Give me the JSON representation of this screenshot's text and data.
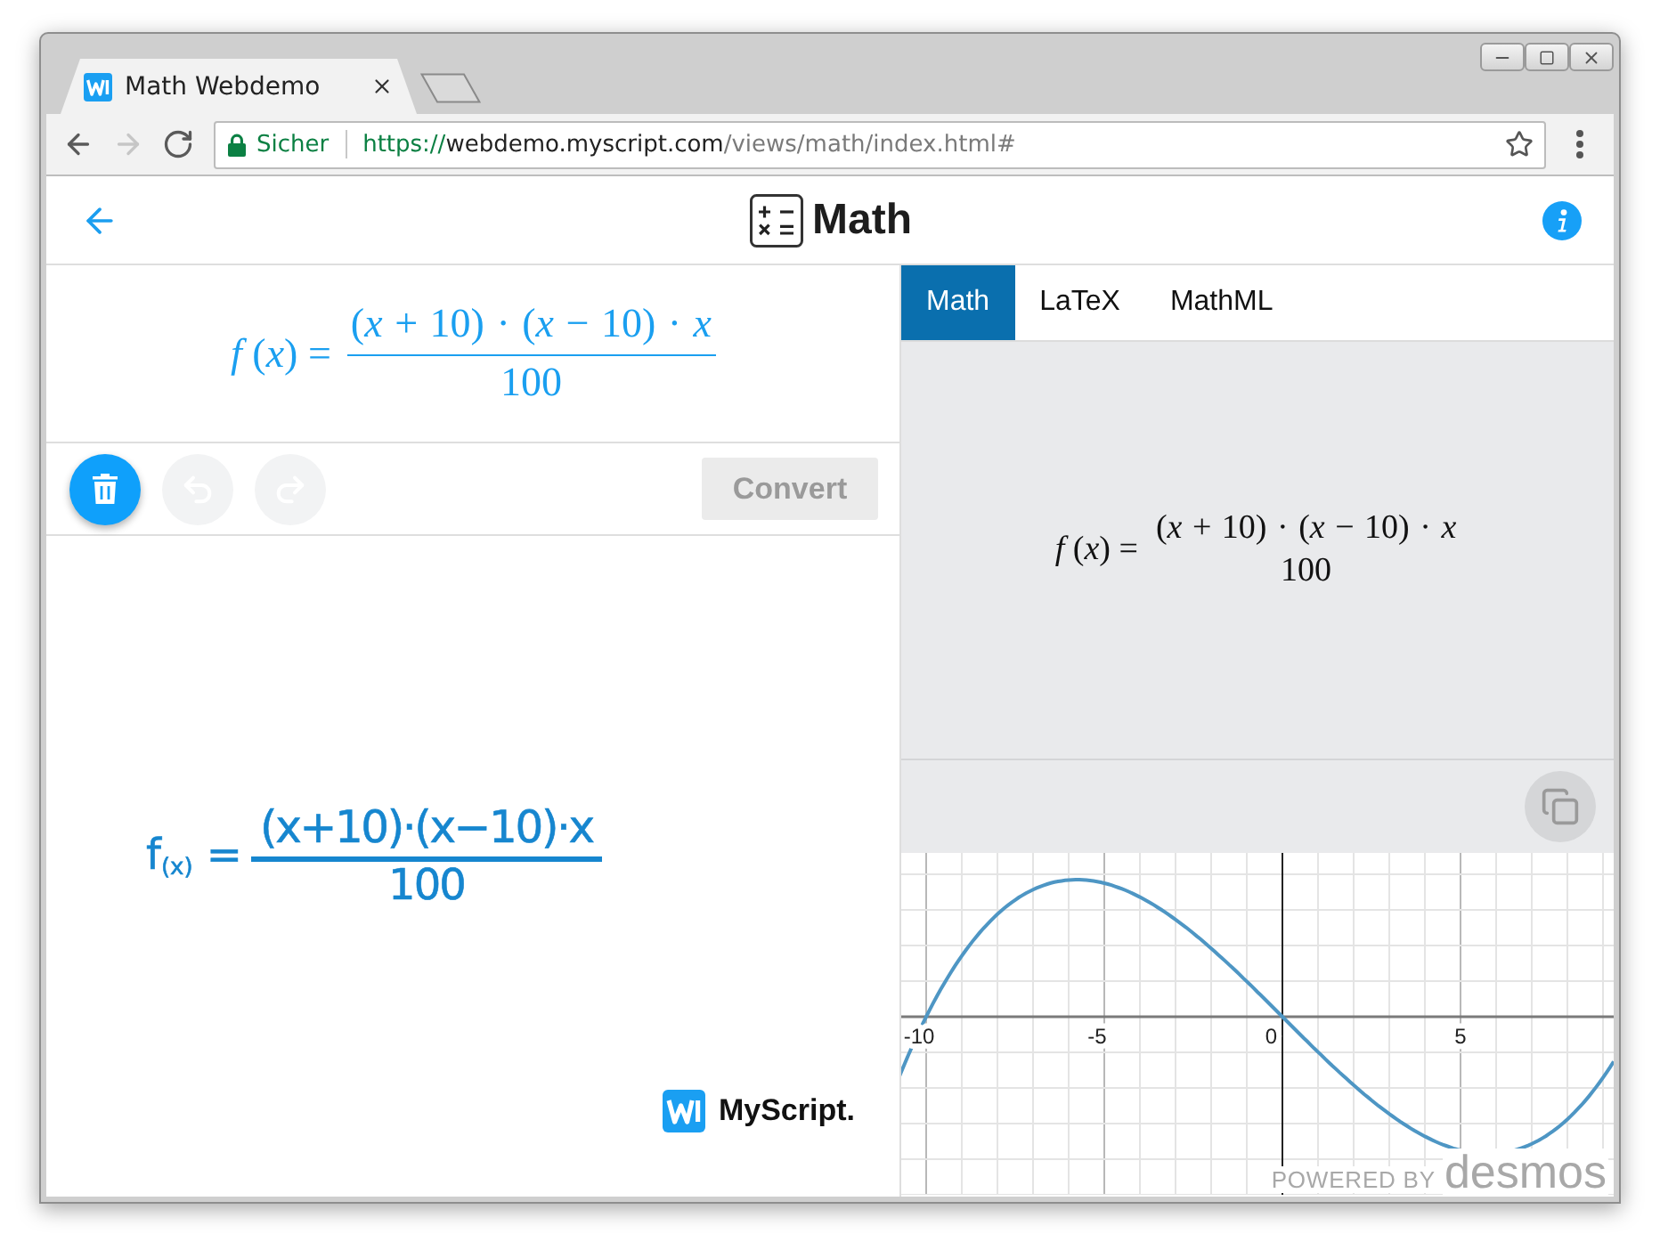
{
  "browser": {
    "tabs": [
      {
        "title": "Math Webdemo",
        "selected": true
      }
    ],
    "nav": [
      {
        "kind": "back",
        "disabled": false
      },
      {
        "kind": "forward",
        "disabled": true
      },
      {
        "kind": "reload",
        "disabled": false
      }
    ],
    "address": {
      "security": "Sicher",
      "scheme": "https://",
      "host": "webdemo.myscript.com",
      "path": "/views/math/index.html#"
    }
  },
  "header": {
    "title": "Math"
  },
  "editor": {
    "result": {
      "lhs": "*f* (*x*) =",
      "numerator": "(*x* + 10) · (*x* − 10) · *x*",
      "denominator": "100"
    },
    "tools": [
      {
        "kind": "clear",
        "disabled": false
      },
      {
        "kind": "undo",
        "disabled": true
      },
      {
        "kind": "redo",
        "disabled": true
      }
    ],
    "convert": {
      "label": "Convert",
      "disabled": true
    },
    "ink": {
      "lhs": "f$_{(x)}$ =",
      "numerator": "(x+10)·(x−10)·x",
      "denominator": "100"
    },
    "brand": "MyScript."
  },
  "output": {
    "tabs": [
      {
        "label": "Math",
        "selected": true
      },
      {
        "label": "LaTeX",
        "selected": false
      },
      {
        "label": "MathML",
        "selected": false
      }
    ],
    "formula": {
      "lhs": "*f* (*x*) =",
      "numerator": "(*x* + 10) · (*x* − 10) · *x*",
      "denominator": "100"
    },
    "graph": {
      "x_ticks": [
        "-10",
        "-5",
        "0",
        "5"
      ],
      "credit": "POWERED BY",
      "brand": "desmos"
    }
  }
}
